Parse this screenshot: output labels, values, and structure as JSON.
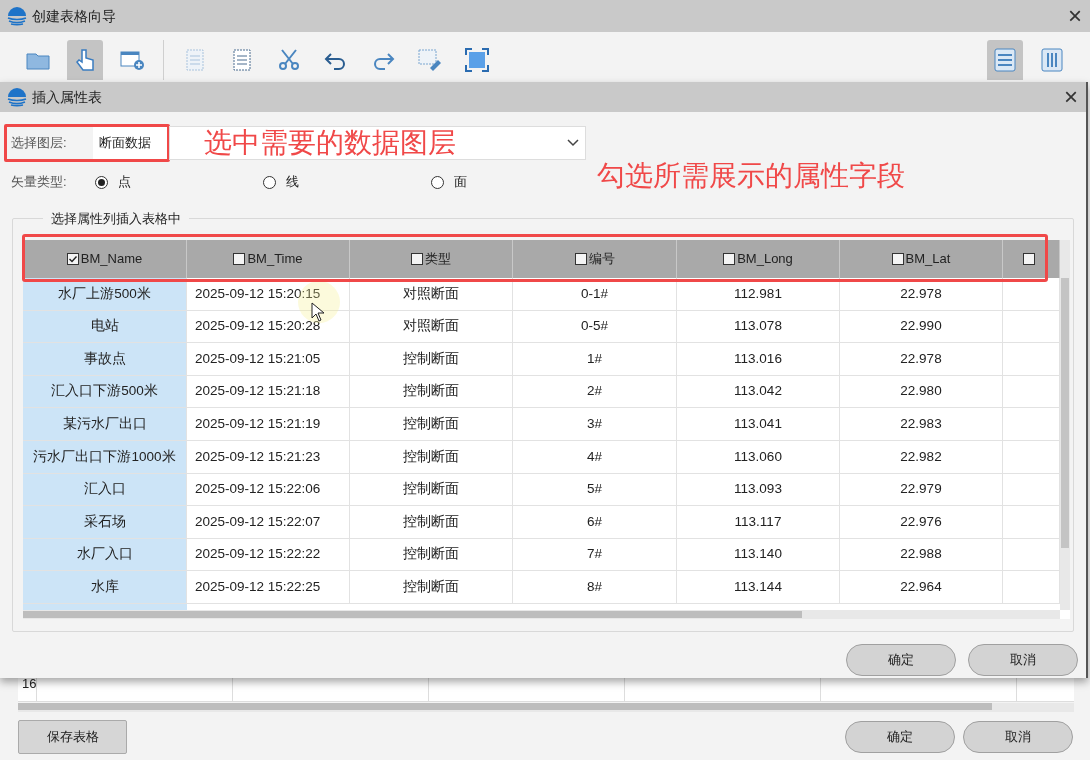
{
  "window": {
    "title": "创建表格向导",
    "close": "×"
  },
  "toolbar": [
    {
      "kind": "folder",
      "selected": false
    },
    {
      "kind": "hand",
      "selected": true
    },
    {
      "kind": "window-add",
      "selected": false
    },
    {
      "kind": "divider"
    },
    {
      "kind": "page",
      "selected": false
    },
    {
      "kind": "doc",
      "selected": false
    },
    {
      "kind": "scissors",
      "selected": false
    },
    {
      "kind": "undo",
      "selected": false
    },
    {
      "kind": "redo",
      "selected": false
    },
    {
      "kind": "text-style",
      "selected": false
    },
    {
      "kind": "frame",
      "selected": false
    }
  ],
  "view_toggle": [
    {
      "kind": "rows",
      "selected": true
    },
    {
      "kind": "columns",
      "selected": false
    }
  ],
  "dialog": {
    "title": "插入属性表",
    "close": "×",
    "layer_label": "选择图层:",
    "layer_value": "断面数据",
    "layer_annotation": "选中需要的数据图层",
    "vector_label": "矢量类型:",
    "vector_types": [
      {
        "label": "点",
        "selected": true
      },
      {
        "label": "线",
        "selected": false
      },
      {
        "label": "面",
        "selected": false
      }
    ],
    "fields_annotation": "勾选所需展示的属性字段",
    "group_title": "选择属性列插入表格中",
    "columns": [
      {
        "label": "BM_Name",
        "checked": true
      },
      {
        "label": "BM_Time",
        "checked": false
      },
      {
        "label": "类型",
        "checked": false
      },
      {
        "label": "编号",
        "checked": false
      },
      {
        "label": "BM_Long",
        "checked": false
      },
      {
        "label": "BM_Lat",
        "checked": false
      },
      {
        "checked": false
      }
    ],
    "rows": [
      [
        "水厂上游500米",
        "2025-09-12 15:20:15",
        "对照断面",
        "0-1#",
        "112.981",
        "22.978"
      ],
      [
        "电站",
        "2025-09-12 15:20:28",
        "对照断面",
        "0-5#",
        "113.078",
        "22.990"
      ],
      [
        "事故点",
        "2025-09-12 15:21:05",
        "控制断面",
        "1#",
        "113.016",
        "22.978"
      ],
      [
        "汇入口下游500米",
        "2025-09-12 15:21:18",
        "控制断面",
        "2#",
        "113.042",
        "22.980"
      ],
      [
        "某污水厂出口",
        "2025-09-12 15:21:19",
        "控制断面",
        "3#",
        "113.041",
        "22.983"
      ],
      [
        "污水厂出口下游1000米",
        "2025-09-12 15:21:23",
        "控制断面",
        "4#",
        "113.060",
        "22.982"
      ],
      [
        "汇入口",
        "2025-09-12 15:22:06",
        "控制断面",
        "5#",
        "113.093",
        "22.979"
      ],
      [
        "采石场",
        "2025-09-12 15:22:07",
        "控制断面",
        "6#",
        "113.117",
        "22.976"
      ],
      [
        "水厂入口",
        "2025-09-12 15:22:22",
        "控制断面",
        "7#",
        "113.140",
        "22.988"
      ],
      [
        "水库",
        "2025-09-12 15:22:25",
        "控制断面",
        "8#",
        "113.144",
        "22.964"
      ]
    ],
    "buttons": [
      "确定",
      "取消"
    ]
  },
  "background_table": {
    "row_label": "16"
  },
  "bottom_buttons": {
    "save": "保存表格",
    "ok": "确定",
    "cancel": "取消"
  }
}
